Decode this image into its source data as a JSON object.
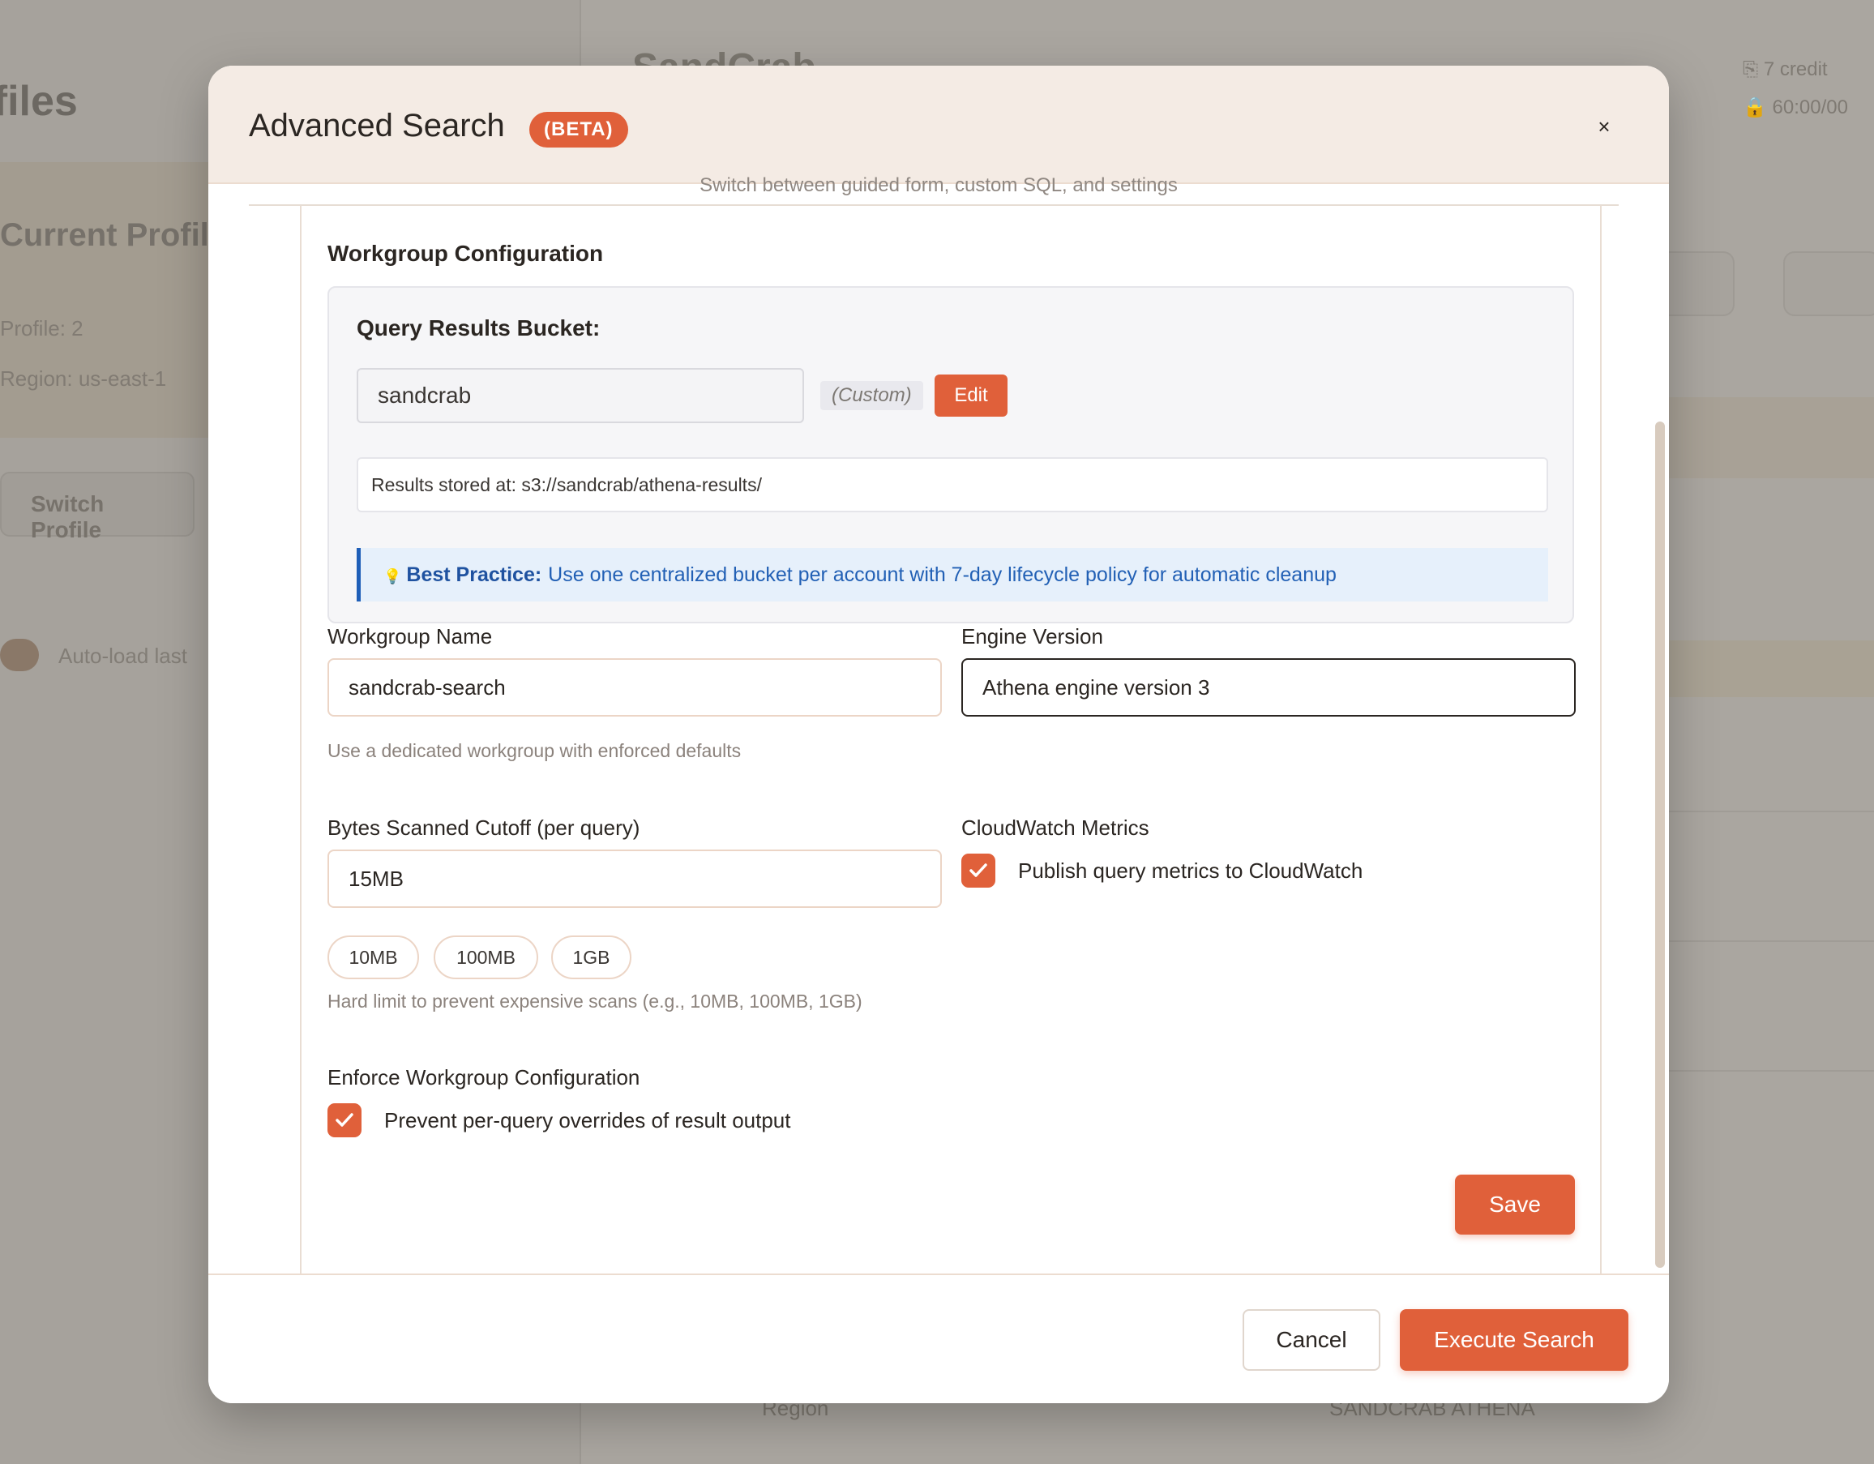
{
  "background": {
    "page_title": "ofiles",
    "card_title": "Current Profile",
    "profile_line": "Profile: 2",
    "region_line": "Region: us-east-1",
    "switch_button": "Switch Profile",
    "auto_load_label": "Auto-load last",
    "right_title": "SandCrab",
    "right_meta_1": "⎘ 7 credit",
    "right_meta_2": "🔒 60:00/00",
    "footer_text_1": "Region",
    "footer_text_2": "SANDCRAB ATHENA"
  },
  "modal": {
    "title": "Advanced Search",
    "badge": "(BETA)",
    "close_label": "×",
    "tabs_subtitle": "Switch between guided form, custom SQL, and settings"
  },
  "workgroup": {
    "section_title": "Workgroup Configuration",
    "bucket": {
      "label": "Query Results Bucket:",
      "value": "sandcrab",
      "tag": "(Custom)",
      "edit_label": "Edit",
      "results_path": "Results stored at: s3://sandcrab/athena-results/",
      "best_practice_icon": "💡",
      "best_practice_title": "Best Practice:",
      "best_practice_text": "Use one centralized bucket per account with 7-day lifecycle policy for automatic cleanup"
    },
    "name_label": "Workgroup Name",
    "name_value": "sandcrab-search",
    "name_help": "Use a dedicated workgroup with enforced defaults",
    "engine_label": "Engine Version",
    "engine_value": "Athena engine version 3",
    "cutoff_label": "Bytes Scanned Cutoff (per query)",
    "cutoff_value": "15MB",
    "cutoff_presets": [
      "10MB",
      "100MB",
      "1GB"
    ],
    "cutoff_help": "Hard limit to prevent expensive scans (e.g., 10MB, 100MB, 1GB)",
    "cloudwatch_label": "CloudWatch Metrics",
    "cloudwatch_checkbox": "Publish query metrics to CloudWatch",
    "cloudwatch_checked": true,
    "enforce_label": "Enforce Workgroup Configuration",
    "enforce_checkbox": "Prevent per-query overrides of result output",
    "enforce_checked": true,
    "save_label": "Save"
  },
  "footer": {
    "cancel_label": "Cancel",
    "execute_label": "Execute Search"
  },
  "colors": {
    "accent": "#e0603a",
    "header_bg": "#f4ebe4",
    "info_blue": "#2260b5"
  }
}
